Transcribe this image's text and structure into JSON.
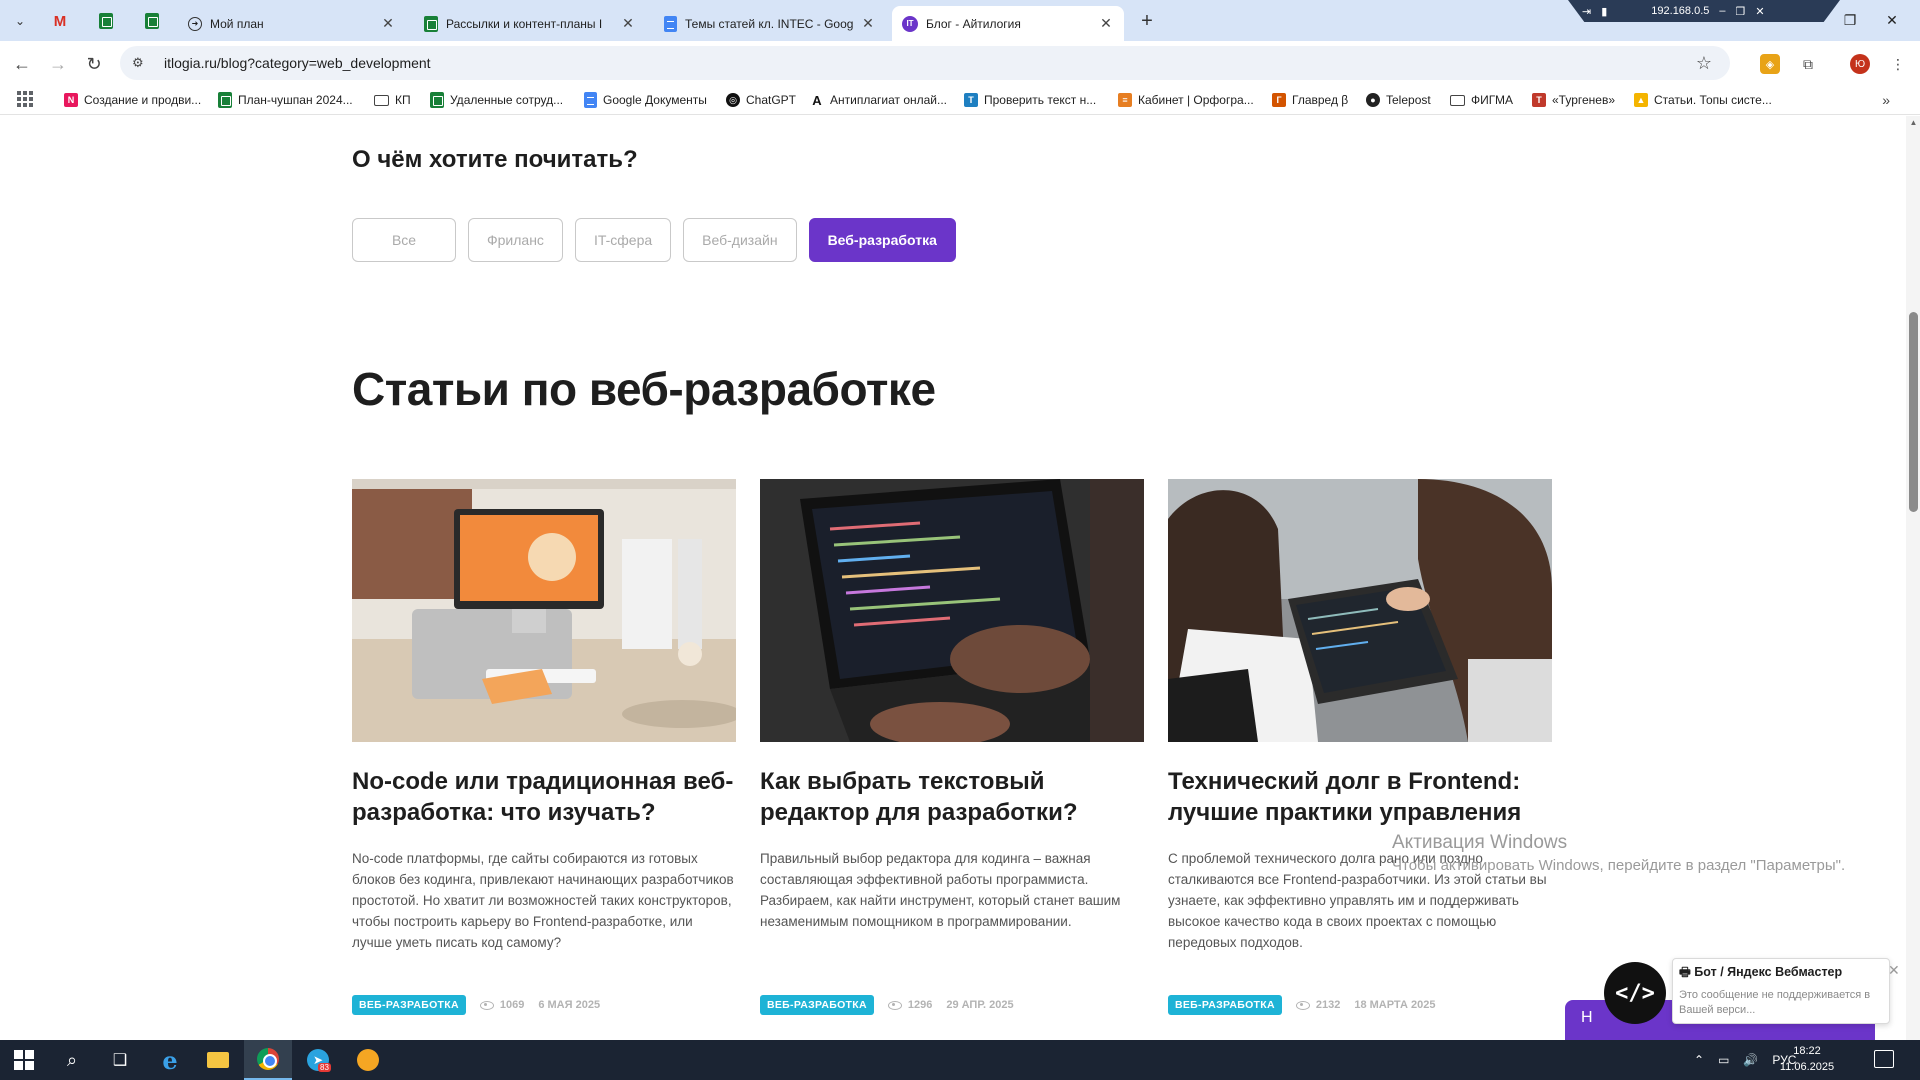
{
  "browser": {
    "tabs": [
      {
        "title": "Мой план",
        "icon": "circle-arrow-icon"
      },
      {
        "title": "Рассылки и контент-планы I",
        "icon": "sheets-icon"
      },
      {
        "title": "Темы статей кл. INTEC - Goog",
        "icon": "docs-icon"
      },
      {
        "title": "Блог - Айтилогия",
        "icon": "itlogia-icon"
      }
    ],
    "vpn_ip": "192.168.0.5",
    "url": "itlogia.ru/blog?category=web_development"
  },
  "bookmarks": [
    {
      "label": "Создание и продви...",
      "icon": "n-icon",
      "color": "#e8175d"
    },
    {
      "label": "План-чушпан 2024...",
      "icon": "sheets-icon",
      "color": "#188038"
    },
    {
      "label": "КП",
      "icon": "folder-icon",
      "color": ""
    },
    {
      "label": "Удаленные сотруд...",
      "icon": "sheets-icon",
      "color": "#188038"
    },
    {
      "label": "Google Документы",
      "icon": "docs-icon",
      "color": "#4285f4"
    },
    {
      "label": "ChatGPT",
      "icon": "chatgpt-icon",
      "color": "#111111"
    },
    {
      "label": "Антиплагиат онлай...",
      "icon": "a-icon",
      "color": "#111111"
    },
    {
      "label": "Проверить текст н...",
      "icon": "text-check-icon",
      "color": "#1e7fc1"
    },
    {
      "label": "Кабинет | Орфогра...",
      "icon": "lines-icon",
      "color": "#e67e22"
    },
    {
      "label": "Главред β",
      "icon": "glavred-icon",
      "color": "#d35400"
    },
    {
      "label": "Telepost",
      "icon": "telepost-icon",
      "color": "#222222"
    },
    {
      "label": "ФИГМА",
      "icon": "folder-icon",
      "color": ""
    },
    {
      "label": "«Тургенев»",
      "icon": "t-icon",
      "color": "#c0392b"
    },
    {
      "label": "Статьи. Топы систе...",
      "icon": "drive-icon",
      "color": "#f4b400"
    }
  ],
  "page": {
    "question_prefix": "О",
    "question": "чём хотите почитать?",
    "filters": [
      "Все",
      "Фриланс",
      "IT-сфера",
      "Веб-дизайн",
      "Веб-разработка"
    ],
    "active_filter": "Веб-разработка",
    "accent": "#6b35c9",
    "section_title": "Статьи по веб-разработке",
    "articles": [
      {
        "title": "No-code или традиционная веб-разработка: что изучать?",
        "excerpt": "No-code платформы, где сайты собираются из готовых блоков без кодинга, привлекают начинающих разработчиков простотой. Но хватит ли возможностей таких конструкторов, чтобы построить карьеру во Frontend-разработке, или лучше уметь писать код самому?",
        "tag": "ВЕБ-РАЗРАБОТКА",
        "views": "1069",
        "date": "6 МАЯ 2025"
      },
      {
        "title": "Как выбрать текстовый редактор для разработки?",
        "excerpt": "Правильный выбор редактора для кодинга – важная составляющая эффективной работы программиста. Разбираем, как найти инструмент, который станет вашим незаменимым помощником в программировании.",
        "tag": "ВЕБ-РАЗРАБОТКА",
        "views": "1296",
        "date": "29 АПР. 2025"
      },
      {
        "title": "Технический долг в Frontend: лучшие практики управления",
        "excerpt": "С проблемой технического долга рано или поздно сталкиваются все Frontend-разработчики. Из этой статьи вы узнаете, как эффективно управлять им и поддерживать высокое качество кода в своих проектах с помощью передовых подходов.",
        "tag": "ВЕБ-РАЗРАБОТКА",
        "views": "2132",
        "date": "18 МАРТА 2025"
      }
    ],
    "tag_color": "#1eb3d6"
  },
  "overlay": {
    "activation_title": "Активация Windows",
    "activation_text": "Чтобы активировать Windows, перейдите в раздел \"Параметры\".",
    "purple_strip_text": "Н",
    "toast_title": "Бот / Яндекс Вебмастер",
    "toast_text": "Это сообщение не поддерживается в Вашей верси...",
    "bot_avatar_text": "</>"
  },
  "taskbar": {
    "lang": "РУС",
    "time": "18:22",
    "date": "11.06.2025",
    "telegram_badge": "83"
  }
}
